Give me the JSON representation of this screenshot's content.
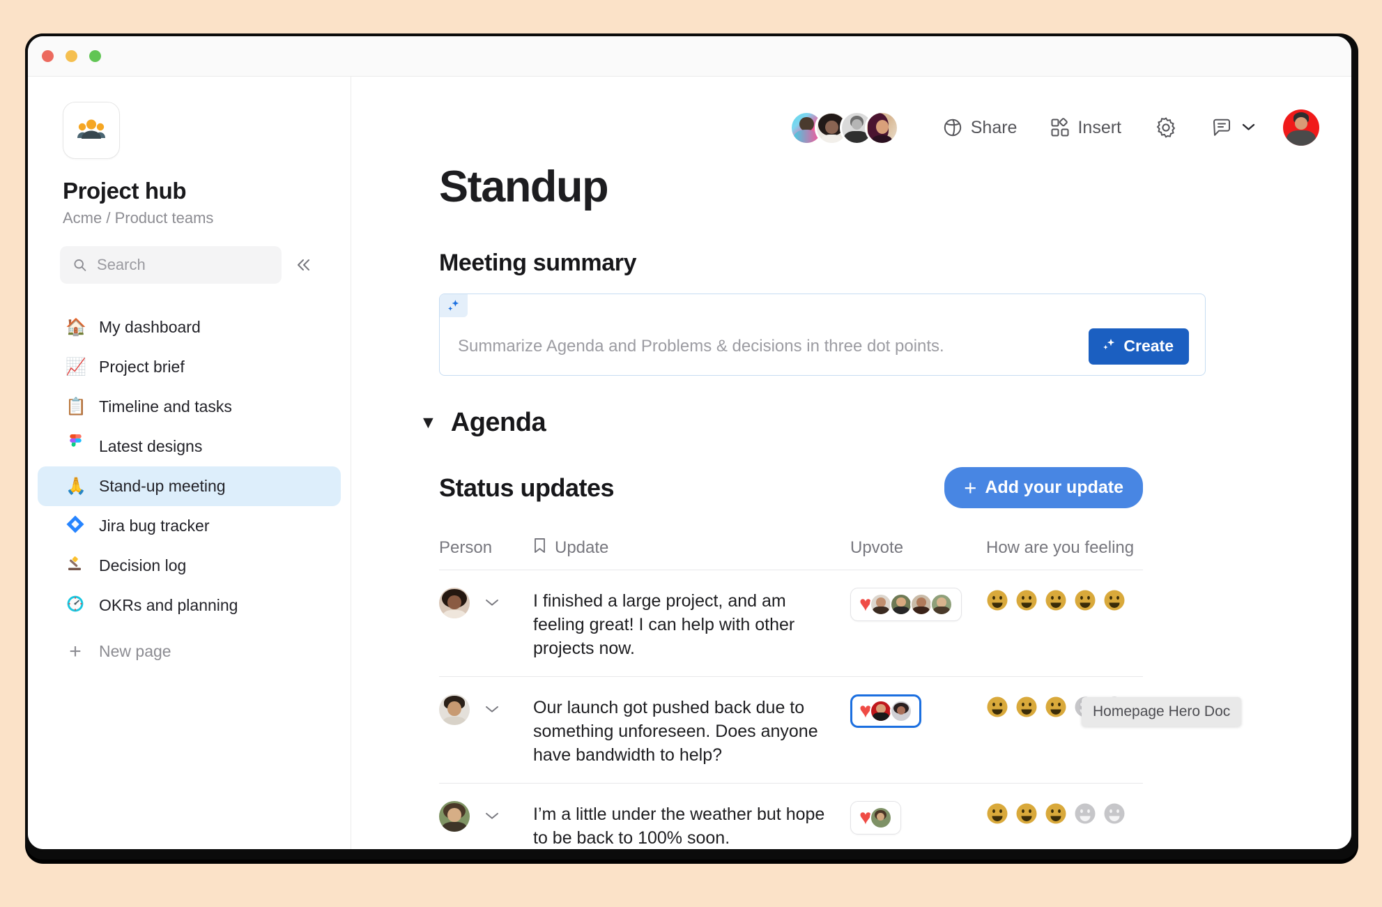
{
  "window": {
    "traffic_lights": [
      "close",
      "minimize",
      "zoom"
    ],
    "colors": {
      "close": "#EC6A5E",
      "minimize": "#F5BF4F",
      "zoom": "#61C554"
    }
  },
  "sidebar": {
    "workspace_icon": "people-group-icon",
    "title": "Project hub",
    "breadcrumb": "Acme / Product teams",
    "search": {
      "placeholder": "Search",
      "value": "",
      "icon": "search-icon"
    },
    "collapse_icon": "chevron-double-left-icon",
    "items": [
      {
        "label": "My dashboard",
        "emoji": "🏠",
        "icon": "house-icon",
        "active": false
      },
      {
        "label": "Project brief",
        "emoji": "📈",
        "icon": "chart-up-icon",
        "active": false
      },
      {
        "label": "Timeline and tasks",
        "emoji": "📋",
        "icon": "clipboard-icon",
        "active": false
      },
      {
        "label": "Latest designs",
        "emoji": "🎨",
        "icon": "figma-icon",
        "active": false
      },
      {
        "label": "Stand-up meeting",
        "emoji": "🙏",
        "icon": "praying-hands-icon",
        "active": true
      },
      {
        "label": "Jira bug tracker",
        "emoji": "🔷",
        "icon": "jira-icon",
        "active": false
      },
      {
        "label": "Decision log",
        "emoji": "🔨",
        "icon": "gavel-icon",
        "active": false
      },
      {
        "label": "OKRs and planning",
        "emoji": "⏱️",
        "icon": "compass-icon",
        "active": false
      }
    ],
    "new_page": {
      "label": "New page",
      "icon": "plus-icon"
    }
  },
  "toolbar": {
    "collaborators": [
      {
        "name": "collaborator-1",
        "colors": [
          "#5ED8E8",
          "#F05A9B",
          "#4A3A2E"
        ]
      },
      {
        "name": "collaborator-2",
        "colors": [
          "#E9E4DE",
          "#2B2220",
          "#8A6452"
        ]
      },
      {
        "name": "collaborator-3",
        "colors": [
          "#D8D8D8",
          "#3A3A3A",
          "#9A9A9A"
        ]
      },
      {
        "name": "collaborator-4",
        "colors": [
          "#E7C9A8",
          "#5A1E3C",
          "#2A1020"
        ]
      }
    ],
    "share_label": "Share",
    "share_icon": "globe-share-icon",
    "insert_label": "Insert",
    "insert_icon": "insert-grid-icon",
    "settings_icon": "gear-icon",
    "comments_icon": "comment-bubble-icon",
    "chevron_icon": "chevron-down-icon",
    "profile": {
      "name": "current-user-avatar",
      "colors": [
        "#F01A1A",
        "#3C3C3C",
        "#D99B76"
      ]
    }
  },
  "document": {
    "title": "Standup",
    "meeting_summary": {
      "heading": "Meeting summary",
      "ai_icon": "sparkles-icon",
      "placeholder": "Summarize Agenda and Problems & decisions in three dot points.",
      "value": "",
      "create_button": {
        "label": "Create",
        "icon": "sparkles-icon",
        "color": "#1B5FC1"
      }
    },
    "agenda": {
      "caret_icon": "caret-down-icon",
      "title": "Agenda",
      "expanded": true
    },
    "status_updates": {
      "title": "Status updates",
      "add_button": {
        "label": "Add your update",
        "icon": "plus-icon",
        "color": "#4886E3"
      },
      "columns": [
        {
          "key": "person",
          "label": "Person",
          "icon": null
        },
        {
          "key": "update",
          "label": "Update",
          "icon": "bookmark-icon"
        },
        {
          "key": "upvote",
          "label": "Upvote",
          "icon": null
        },
        {
          "key": "feeling",
          "label": "How are you feeling",
          "icon": null
        }
      ],
      "rows": [
        {
          "person": {
            "name": "row-avatar-1",
            "colors": [
              "#D9C7B8",
              "#2A1A14",
              "#8A5A42"
            ]
          },
          "chevron_icon": "chevron-down-icon",
          "update": "I finished a large project, and am feeling great! I can help with other projects now.",
          "upvote": {
            "selected": false,
            "heart_icon": "heart-icon",
            "voters": [
              {
                "name": "voter-1",
                "colors": [
                  "#DCD6CE",
                  "#3A2A20",
                  "#C08E6E"
                ]
              },
              {
                "name": "voter-2",
                "colors": [
                  "#6E7A55",
                  "#262626",
                  "#D7A97F"
                ]
              },
              {
                "name": "voter-3",
                "colors": [
                  "#C9BBA8",
                  "#3A2218",
                  "#B07A5A"
                ]
              },
              {
                "name": "voter-4",
                "colors": [
                  "#8FA07A",
                  "#4A3A2A",
                  "#D9B48E"
                ]
              }
            ]
          },
          "feeling": {
            "filled": 5,
            "total": 5
          }
        },
        {
          "person": {
            "name": "row-avatar-2",
            "colors": [
              "#E4E0DA",
              "#2A2018",
              "#C79A72"
            ]
          },
          "chevron_icon": "chevron-down-icon",
          "update": "Our launch got pushed back due to something unforeseen. Does anyone have bandwidth to help?",
          "upvote": {
            "selected": true,
            "heart_icon": "heart-icon",
            "voters": [
              {
                "name": "voter-5",
                "colors": [
                  "#C0181C",
                  "#1A1A1A",
                  "#D9A07A"
                ]
              },
              {
                "name": "voter-6",
                "colors": [
                  "#CFCFD4",
                  "#2A2020",
                  "#A9705A"
                ]
              }
            ]
          },
          "feeling": {
            "filled": 3,
            "total": 5
          }
        },
        {
          "person": {
            "name": "row-avatar-3",
            "colors": [
              "#7F9464",
              "#4A3828",
              "#D6AE86"
            ]
          },
          "chevron_icon": "chevron-down-icon",
          "update": "I’m a little under the weather but hope to be back to 100% soon.",
          "upvote": {
            "selected": false,
            "heart_icon": "heart-icon",
            "voters": [
              {
                "name": "voter-7",
                "colors": [
                  "#7E9166",
                  "#4A3626",
                  "#D2A87F"
                ]
              }
            ]
          },
          "feeling": {
            "filled": 3,
            "total": 5
          }
        }
      ]
    }
  },
  "tooltip": {
    "text": "Homepage Hero Doc",
    "visible": true
  },
  "theme": {
    "page_background": "#FBE2C8",
    "accent_blue": "#4886E3",
    "accent_blue_dark": "#1B5FC1",
    "active_nav": "#DDEEFB",
    "emoji_yellow": "#D9A93B",
    "emoji_grey": "#C6C6C9",
    "heart_red": "#EF4B45"
  }
}
